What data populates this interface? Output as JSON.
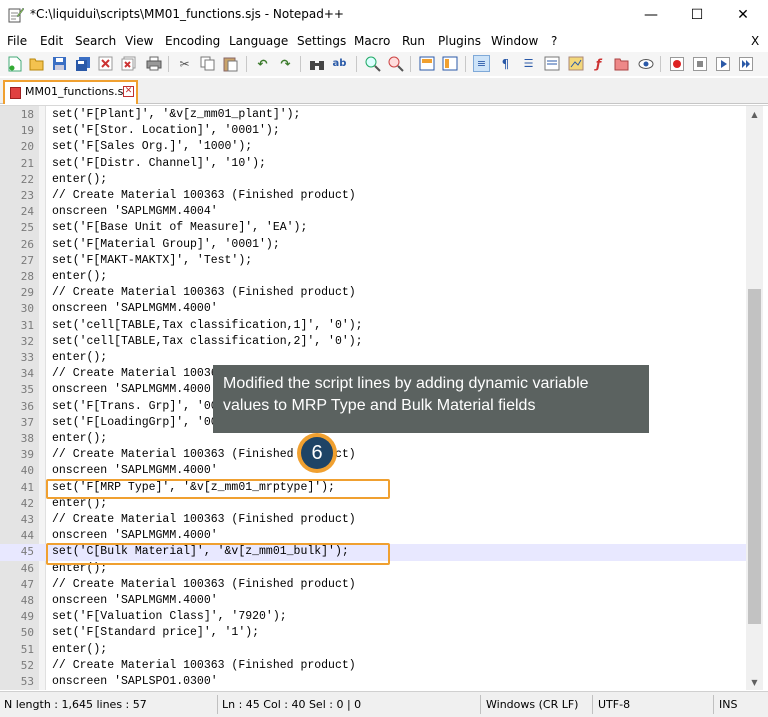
{
  "window": {
    "title": "*C:\\liquidui\\scripts\\MM01_functions.sjs - Notepad++",
    "minimize": "—",
    "maximize": "☐",
    "close": "✕"
  },
  "menu": {
    "items": [
      "File",
      "Edit",
      "Search",
      "View",
      "Encoding",
      "Language",
      "Settings",
      "Macro",
      "Run",
      "Plugins",
      "Window",
      "?"
    ],
    "close_label": "X"
  },
  "toolbar": {
    "icons": [
      "new-file",
      "open-file",
      "save",
      "save-all",
      "close",
      "close-all",
      "print",
      "cut",
      "copy",
      "paste",
      "undo",
      "redo",
      "find",
      "replace",
      "zoom-in",
      "zoom-out",
      "sync-vertical",
      "sync-horizontal",
      "word-wrap",
      "show-all-chars",
      "indent-guide",
      "document-map",
      "function-list",
      "folder-as-workspace",
      "monitoring",
      "record-macro",
      "stop-recording",
      "play-macro",
      "run-macro-multiple",
      "save-macro"
    ]
  },
  "tabs": [
    {
      "label": "MM01_functions.sjs",
      "close": "✕",
      "active": true
    }
  ],
  "editor": {
    "current_line": 45,
    "lines": [
      {
        "n": "18",
        "text": "set('F[Plant]', '&v[z_mm01_plant]');"
      },
      {
        "n": "19",
        "text": "set('F[Stor. Location]', '0001');"
      },
      {
        "n": "20",
        "text": "set('F[Sales Org.]', '1000');"
      },
      {
        "n": "21",
        "text": "set('F[Distr. Channel]', '10');"
      },
      {
        "n": "22",
        "text": "enter();"
      },
      {
        "n": "23",
        "text": "// Create Material 100363 (Finished product)"
      },
      {
        "n": "24",
        "text": "onscreen 'SAPLMGMM.4004'"
      },
      {
        "n": "25",
        "text": "set('F[Base Unit of Measure]', 'EA');"
      },
      {
        "n": "26",
        "text": "set('F[Material Group]', '0001');"
      },
      {
        "n": "27",
        "text": "set('F[MAKT-MAKTX]', 'Test');"
      },
      {
        "n": "28",
        "text": "enter();"
      },
      {
        "n": "29",
        "text": "// Create Material 100363 (Finished product)"
      },
      {
        "n": "30",
        "text": "onscreen 'SAPLMGMM.4000'"
      },
      {
        "n": "31",
        "text": "set('cell[TABLE,Tax classification,1]', '0');"
      },
      {
        "n": "32",
        "text": "set('cell[TABLE,Tax classification,2]', '0');"
      },
      {
        "n": "33",
        "text": "enter();"
      },
      {
        "n": "34",
        "text": "// Create Material 100363 (Finished product)"
      },
      {
        "n": "35",
        "text": "onscreen 'SAPLMGMM.4000'"
      },
      {
        "n": "36",
        "text": "set('F[Trans. Grp]', '0001');"
      },
      {
        "n": "37",
        "text": "set('F[LoadingGrp]', '0001');"
      },
      {
        "n": "38",
        "text": "enter();"
      },
      {
        "n": "39",
        "text": "// Create Material 100363 (Finished product)"
      },
      {
        "n": "40",
        "text": "onscreen 'SAPLMGMM.4000'"
      },
      {
        "n": "41",
        "text": "set('F[MRP Type]', '&v[z_mm01_mrptype]');"
      },
      {
        "n": "42",
        "text": "enter();"
      },
      {
        "n": "43",
        "text": "// Create Material 100363 (Finished product)"
      },
      {
        "n": "44",
        "text": "onscreen 'SAPLMGMM.4000'"
      },
      {
        "n": "45",
        "text": "set('C[Bulk Material]', '&v[z_mm01_bulk]');"
      },
      {
        "n": "46",
        "text": "enter();"
      },
      {
        "n": "47",
        "text": "// Create Material 100363 (Finished product)"
      },
      {
        "n": "48",
        "text": "onscreen 'SAPLMGMM.4000'"
      },
      {
        "n": "49",
        "text": "set('F[Valuation Class]', '7920');"
      },
      {
        "n": "50",
        "text": "set('F[Standard price]', '1');"
      },
      {
        "n": "51",
        "text": "enter();"
      },
      {
        "n": "52",
        "text": "// Create Material 100363 (Finished product)"
      },
      {
        "n": "53",
        "text": "onscreen 'SAPLSPO1.0300'"
      }
    ]
  },
  "annotation": {
    "callout_text": "Modified the script lines by adding dynamic variable values to MRP Type and Bulk Material fields",
    "step_number": "6",
    "accent_color": "#f0a030",
    "callout_color": "#5b6260",
    "badge_color": "#1e4466"
  },
  "statusbar": {
    "length": "N  length : 1,645    lines : 57",
    "position": "Ln : 45    Col : 40    Sel : 0 | 0",
    "eol": "Windows (CR LF)",
    "encoding": "UTF-8",
    "mode": "INS"
  }
}
